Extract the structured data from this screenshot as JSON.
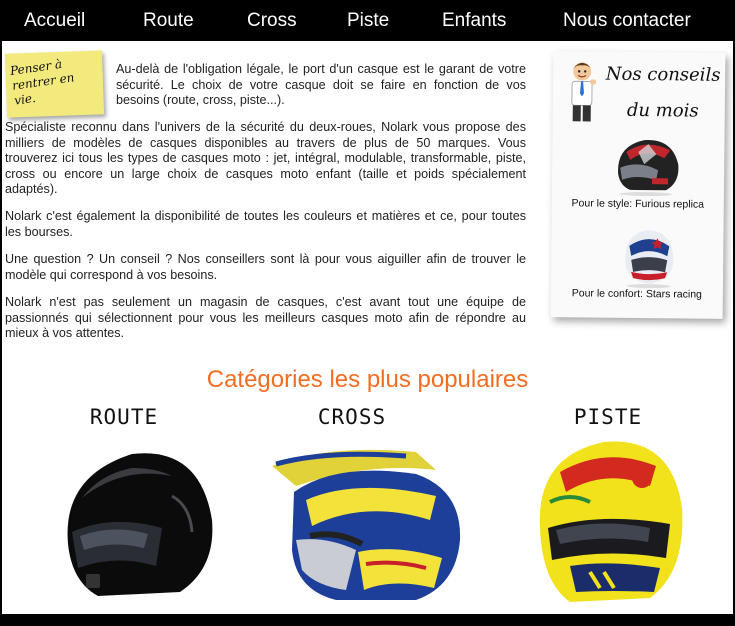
{
  "nav": {
    "items": [
      {
        "label": "Accueil"
      },
      {
        "label": "Route"
      },
      {
        "label": "Cross"
      },
      {
        "label": "Piste"
      },
      {
        "label": "Enfants"
      },
      {
        "label": "Nous contacter"
      }
    ]
  },
  "sticky_note": {
    "text": "Penser à rentrer en vie."
  },
  "intro": {
    "p1": "Au-delà de l'obligation légale, le port d'un casque est le garant de votre sécurité. Le choix de votre casque doit se faire en fonction de vos besoins (route, cross, piste...).",
    "p2": "Spécialiste reconnu dans l'univers de la sécurité du deux-roues, Nolark vous propose des milliers de modèles de casques disponibles au travers de plus de 50 marques. Vous trouverez ici tous les types de casques moto : jet, intégral, modulable, transformable, piste, cross ou encore un large choix de casques moto enfant (taille et poids spécialement adaptés).",
    "p3": "Nolark c'est également la disponibilité de toutes les couleurs et matières et ce, pour toutes les bourses.",
    "p4": "Une question ? Un conseil ? Nos conseillers sont là pour vous aiguiller afin de trouver le modèle qui correspond à vos besoins.",
    "p5": "Nolark n'est pas seulement un magasin de casques, c'est avant tout une équipe de passionnés qui sélectionnent pour vous les meilleurs casques moto afin de répondre au mieux à vos attentes."
  },
  "conseils": {
    "title": "Nos conseils du mois",
    "picks": [
      {
        "label": "Pour le style: Furious replica"
      },
      {
        "label": "Pour le confort: Stars racing"
      }
    ]
  },
  "categories": {
    "heading": "Catégories les plus populaires",
    "items": [
      {
        "label": "ROUTE"
      },
      {
        "label": "CROSS"
      },
      {
        "label": "PISTE"
      }
    ]
  },
  "colors": {
    "accent": "#f26d21",
    "nav_bg": "#000000",
    "sticky": "#f3ea7e"
  }
}
